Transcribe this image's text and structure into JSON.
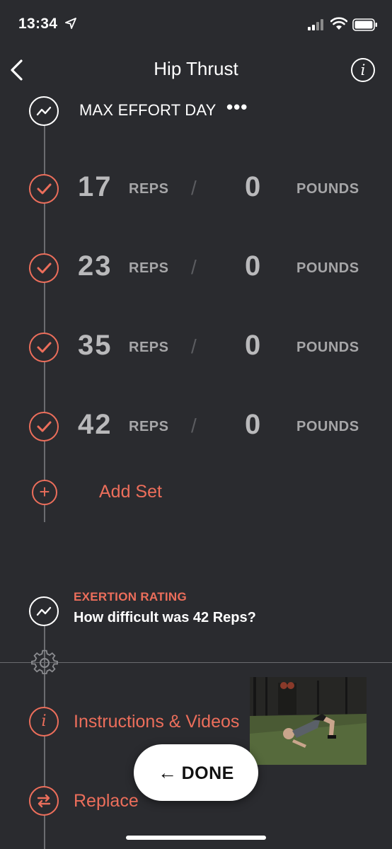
{
  "status_bar": {
    "time": "13:34"
  },
  "header": {
    "title": "Hip Thrust"
  },
  "section": {
    "title": "MAX EFFORT DAY",
    "menu_dots": "•••"
  },
  "sets": [
    {
      "reps": "17",
      "reps_label": "REPS",
      "separator": "/",
      "weight": "0",
      "weight_label": "POUNDS",
      "completed": true
    },
    {
      "reps": "23",
      "reps_label": "REPS",
      "separator": "/",
      "weight": "0",
      "weight_label": "POUNDS",
      "completed": true
    },
    {
      "reps": "35",
      "reps_label": "REPS",
      "separator": "/",
      "weight": "0",
      "weight_label": "POUNDS",
      "completed": true
    },
    {
      "reps": "42",
      "reps_label": "REPS",
      "separator": "/",
      "weight": "0",
      "weight_label": "POUNDS",
      "completed": true
    }
  ],
  "add_set": {
    "label": "Add Set"
  },
  "exertion": {
    "label": "EXERTION RATING",
    "question": "How difficult was 42 Reps?"
  },
  "menu": {
    "instructions_label": "Instructions & Videos",
    "replace_label": "Replace"
  },
  "done_button": {
    "label": "DONE",
    "arrow": "←"
  },
  "colors": {
    "accent": "#ec6e5b",
    "background": "#2a2b2f",
    "muted_text": "#b9b9bb"
  },
  "icons": [
    "location-arrow-icon",
    "signal-icon",
    "wifi-icon",
    "battery-icon",
    "back-chevron-icon",
    "info-icon",
    "trend-icon",
    "check-icon",
    "plus-icon",
    "gear-icon",
    "swap-icon",
    "arrow-left-icon"
  ]
}
